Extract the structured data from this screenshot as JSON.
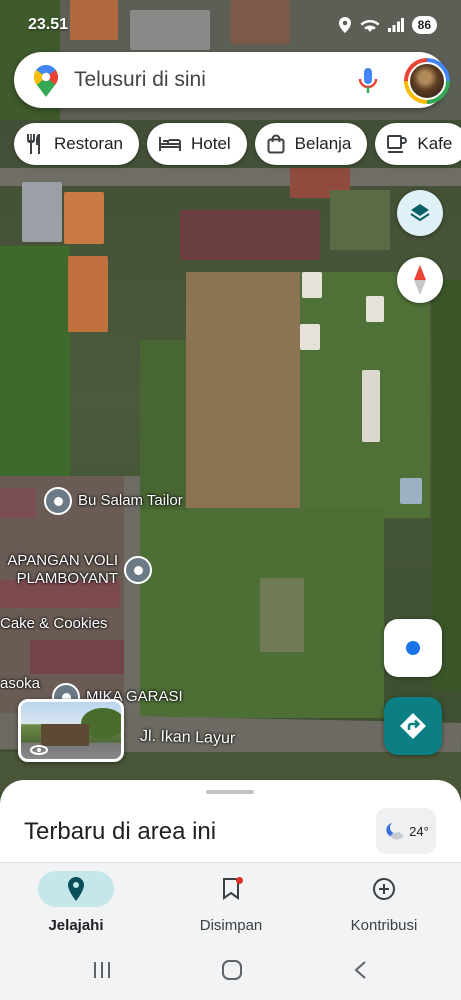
{
  "status_bar": {
    "time": "23.51",
    "battery": "86"
  },
  "search": {
    "placeholder": "Telusuri di sini"
  },
  "chips": [
    {
      "label": "Restoran",
      "icon": "fork-knife-icon"
    },
    {
      "label": "Hotel",
      "icon": "bed-icon"
    },
    {
      "label": "Belanja",
      "icon": "shopping-bag-icon"
    },
    {
      "label": "Kafe",
      "icon": "coffee-cup-icon"
    }
  ],
  "map": {
    "places": [
      {
        "name": "Bu Salam Tailor"
      },
      {
        "name": "APANGAN VOLI\nPLAMBOYANT"
      },
      {
        "name": "Cake & Cookies"
      },
      {
        "name": "asoka"
      },
      {
        "name": "MIKA GARASI"
      }
    ],
    "road": "Jl. Ikan Layur"
  },
  "sheet": {
    "title": "Terbaru di area ini",
    "weather_temp": "24°"
  },
  "bottom_nav": [
    {
      "label": "Jelajahi",
      "active": true
    },
    {
      "label": "Disimpan",
      "active": false
    },
    {
      "label": "Kontribusi",
      "active": false
    }
  ],
  "colors": {
    "accent": "#0b7f83",
    "active_tab_bg": "#c5e7ea",
    "locate_dot": "#1a73e8",
    "compass_red": "#ea4335"
  }
}
